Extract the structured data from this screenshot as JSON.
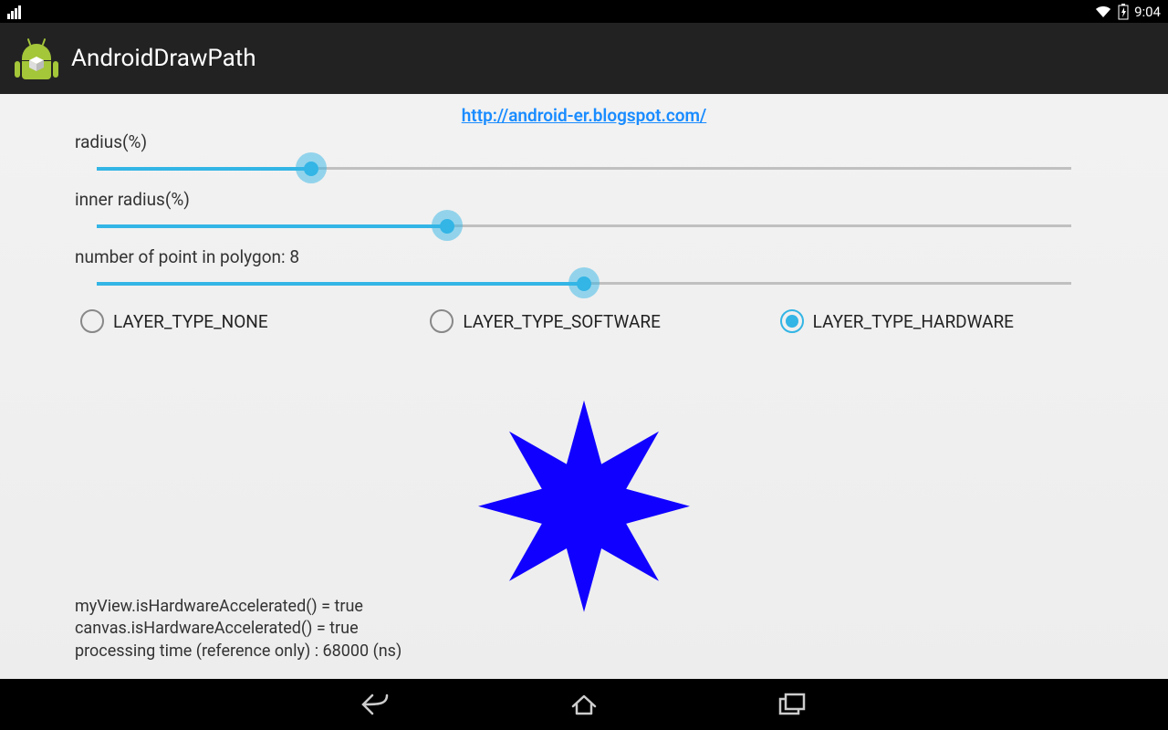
{
  "status": {
    "time": "9:04"
  },
  "appbar": {
    "title": "AndroidDrawPath"
  },
  "link": {
    "url_text": "http://android-er.blogspot.com/"
  },
  "sliders": {
    "radius": {
      "label": "radius(%)",
      "percent": 22
    },
    "inner": {
      "label": "inner radius(%)",
      "percent": 36
    },
    "points": {
      "label": "number of point in polygon: 8",
      "percent": 50,
      "value": 8
    }
  },
  "radios": {
    "options": [
      {
        "label": "LAYER_TYPE_NONE",
        "selected": false
      },
      {
        "label": "LAYER_TYPE_SOFTWARE",
        "selected": false
      },
      {
        "label": "LAYER_TYPE_HARDWARE",
        "selected": true
      }
    ]
  },
  "star": {
    "points": 8,
    "outer_r": 116,
    "inner_r": 50,
    "fill": "#1000ff"
  },
  "info": {
    "l1": "myView.isHardwareAccelerated() = true",
    "l2": "canvas.isHardwareAccelerated() = true",
    "l3": "processing time (reference only) : 68000 (ns)"
  }
}
